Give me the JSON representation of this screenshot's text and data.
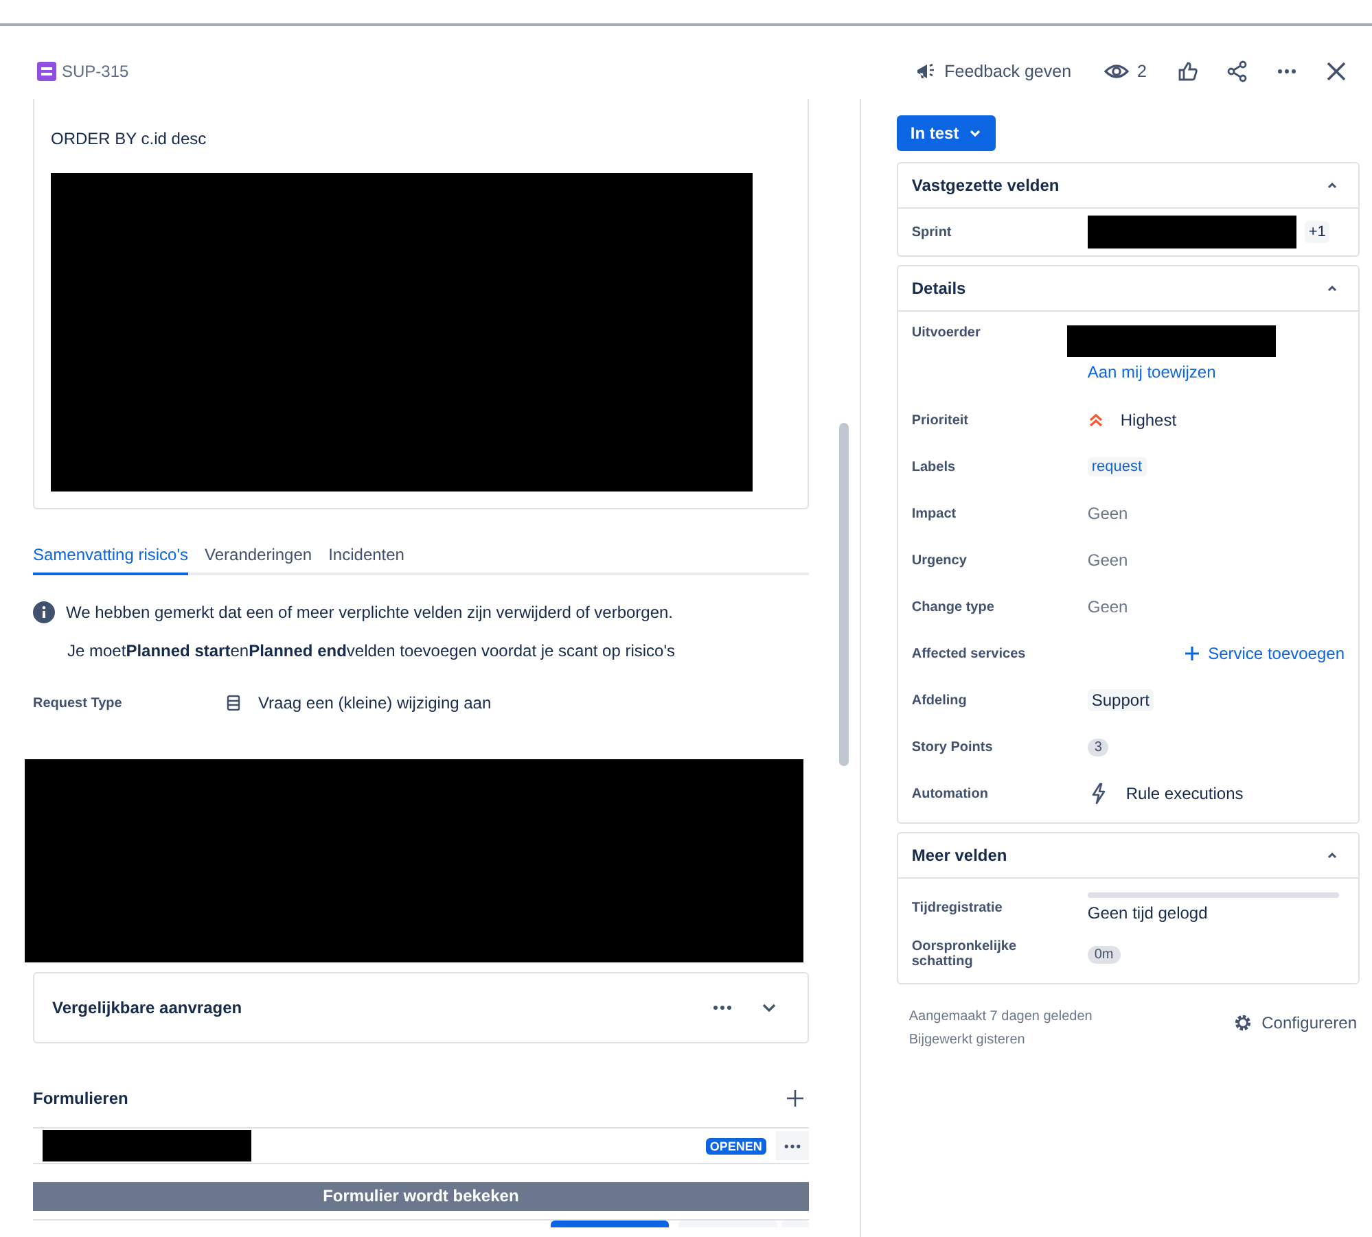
{
  "header": {
    "issue_key": "SUP-315",
    "feedback": "Feedback geven",
    "watchers": "2"
  },
  "description": {
    "code_line": "ORDER BY c.id desc"
  },
  "tabs": [
    {
      "label": "Samenvatting risico's",
      "selected": true
    },
    {
      "label": "Veranderingen",
      "selected": false
    },
    {
      "label": "Incidenten",
      "selected": false
    }
  ],
  "notice": {
    "message": "We hebben gemerkt dat een of meer verplichte velden zijn verwijderd of verborgen.",
    "detail": "Je moet**Planned start**en**Planned end**velden toevoegen voordat je scant op risico's"
  },
  "request_type": {
    "label": "Request Type",
    "value": "Vraag een (kleine) wijziging aan"
  },
  "similar_requests": {
    "title": "Vergelijkbare aanvragen",
    "expanded": false
  },
  "forms": {
    "title": "Formulieren",
    "status": "OPENEN",
    "banner": "Formulier wordt bekeken"
  },
  "status_button": "In test",
  "pinned": {
    "title": "Vastgezette velden",
    "expanded": true,
    "fields": [
      {
        "label": "Sprint",
        "extra": "+1"
      }
    ]
  },
  "details": {
    "title": "Details",
    "expanded": true,
    "fields": [
      {
        "kind": "assignee",
        "label": "Uitvoerder",
        "link": "Aan mij toewijzen"
      },
      {
        "kind": "priority",
        "label": "Prioriteit",
        "value": "Highest"
      },
      {
        "kind": "label",
        "label": "Labels",
        "value": "request"
      },
      {
        "kind": "text",
        "label": "Impact",
        "value": "Geen"
      },
      {
        "kind": "text",
        "label": "Urgency",
        "value": "Geen"
      },
      {
        "kind": "text",
        "label": "Change type",
        "value": "Geen"
      },
      {
        "kind": "add",
        "label": "Affected services",
        "value": "Service toevoegen"
      },
      {
        "kind": "tag",
        "label": "Afdeling",
        "value": "Support"
      },
      {
        "kind": "badge",
        "label": "Story Points",
        "value": "3"
      },
      {
        "kind": "automation",
        "label": "Automation",
        "value": "Rule executions"
      }
    ]
  },
  "more_fields": {
    "title": "Meer velden",
    "expanded": true,
    "time_tracking": {
      "label": "Tijdregistratie",
      "level": 0,
      "value": "Geen tijd gelogd"
    },
    "estimate": {
      "label": "Oorspronkelijke schatting",
      "value": "0m"
    }
  },
  "footer": {
    "created": "Aangemaakt 7 dagen geleden",
    "updated": "Bijgewerkt gisteren",
    "configure": "Configureren"
  }
}
